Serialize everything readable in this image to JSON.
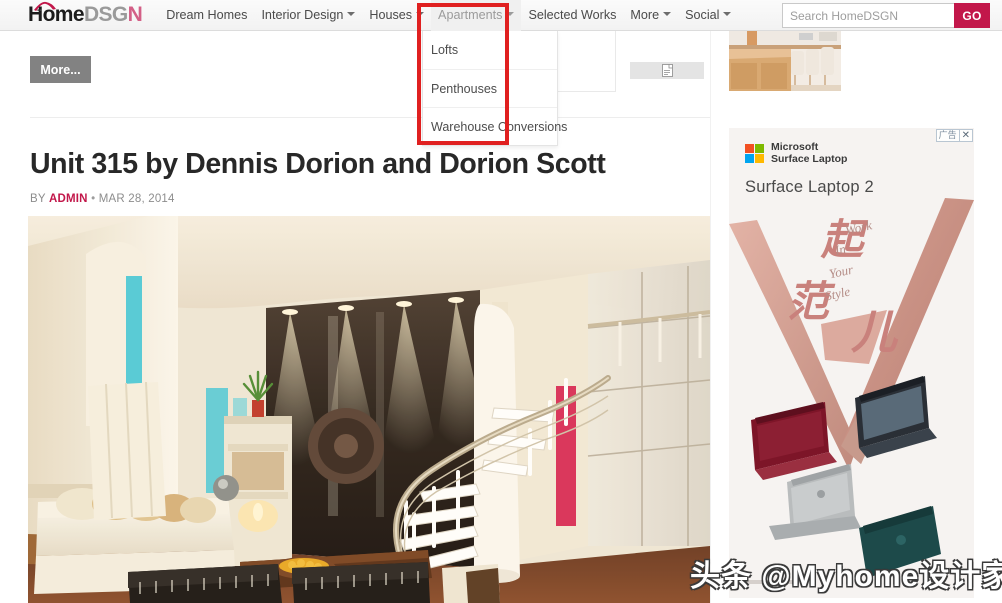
{
  "site": {
    "logo": {
      "part1": "Home",
      "part2": "DSG",
      "part3": "N",
      "icon": "roof-icon"
    },
    "colors": {
      "brand_crimson": "#c2174a",
      "logo_pink": "#d35f86",
      "logo_gray": "#9a9a9a",
      "highlight_red": "#e02020",
      "more_button_gray": "#828282"
    }
  },
  "nav": {
    "items": [
      {
        "label": "Dream Homes",
        "has_caret": false,
        "active": false
      },
      {
        "label": "Interior Design",
        "has_caret": true,
        "active": false
      },
      {
        "label": "Houses",
        "has_caret": true,
        "active": false
      },
      {
        "label": "Apartments",
        "has_caret": true,
        "active": true
      },
      {
        "label": "Selected Works",
        "has_caret": false,
        "active": false
      },
      {
        "label": "More",
        "has_caret": true,
        "active": false
      },
      {
        "label": "Social",
        "has_caret": true,
        "active": false
      }
    ]
  },
  "search": {
    "placeholder": "Search HomeDSGN",
    "value": "",
    "button_label": "GO"
  },
  "dropdown": {
    "parent": "Apartments",
    "items": [
      {
        "label": "Lofts"
      },
      {
        "label": "Penthouses"
      },
      {
        "label": "Warehouse Conversions"
      }
    ]
  },
  "toolbar": {
    "more_label": "More..."
  },
  "article": {
    "title": "Unit 315 by Dennis Dorion and Dorion Scott",
    "byline_prefix": "BY",
    "author": "ADMIN",
    "separator": "•",
    "date": "MAR 28, 2014"
  },
  "ad": {
    "tag": "广告",
    "close": "✕",
    "brand_line1": "Microsoft",
    "brand_line2": "Surface Laptop",
    "headline": "Surface Laptop 2",
    "cn_char1": "起",
    "cn_char2": "范",
    "cn_char3": "儿",
    "tagline_line1": "Work",
    "tagline_line2": "In",
    "tagline_line3": "Your",
    "tagline_line4": "Style"
  },
  "watermark": {
    "text": "头条 @Myhome设计家"
  }
}
